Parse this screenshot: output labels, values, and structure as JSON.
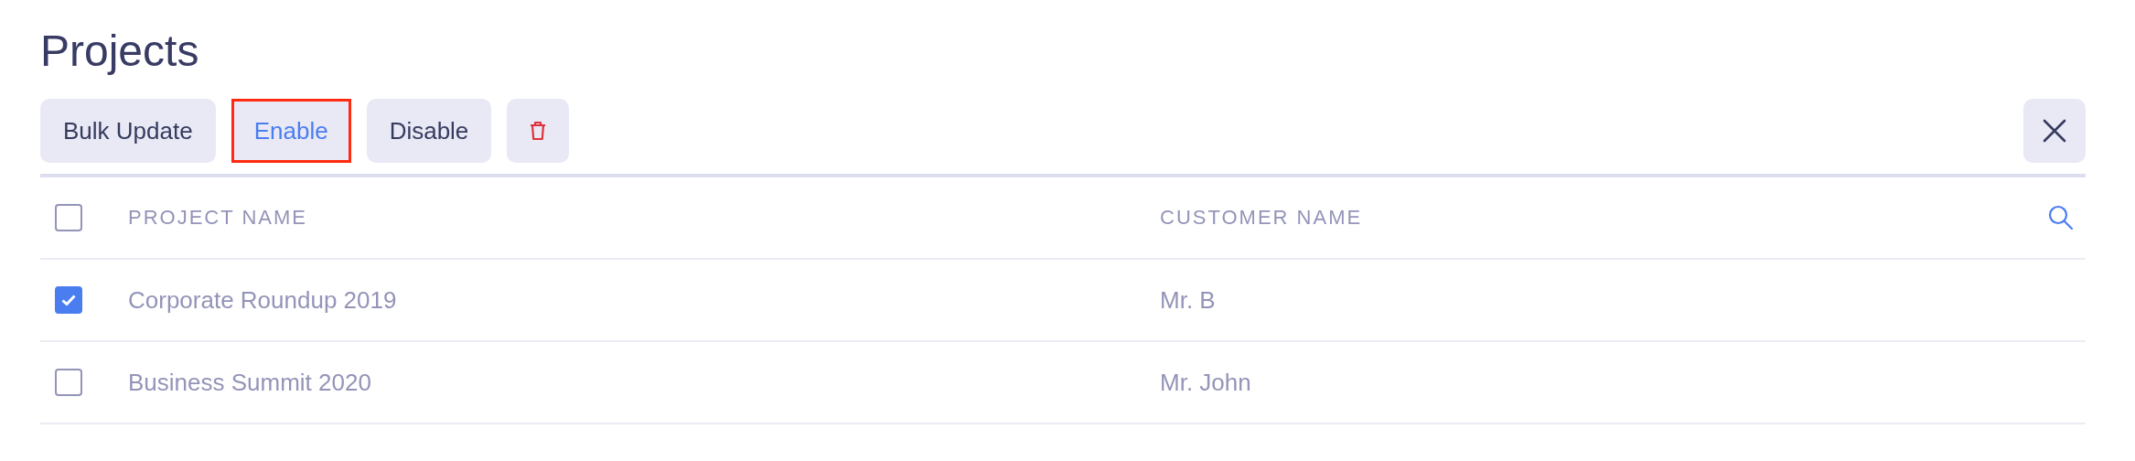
{
  "title": "Projects",
  "toolbar": [
    {
      "kind": "text",
      "label": "Bulk Update",
      "highlighted": false
    },
    {
      "kind": "text",
      "label": "Enable",
      "highlighted": true
    },
    {
      "kind": "text",
      "label": "Disable",
      "highlighted": false
    },
    {
      "kind": "delete",
      "highlighted": false
    }
  ],
  "table": {
    "all_checked": false,
    "columns": [
      "PROJECT NAME",
      "CUSTOMER NAME"
    ],
    "rows": [
      {
        "checked": true,
        "cells": [
          "Corporate Roundup 2019",
          "Mr. B"
        ]
      },
      {
        "checked": false,
        "cells": [
          "Business Summit 2020",
          "Mr. John"
        ]
      }
    ]
  }
}
